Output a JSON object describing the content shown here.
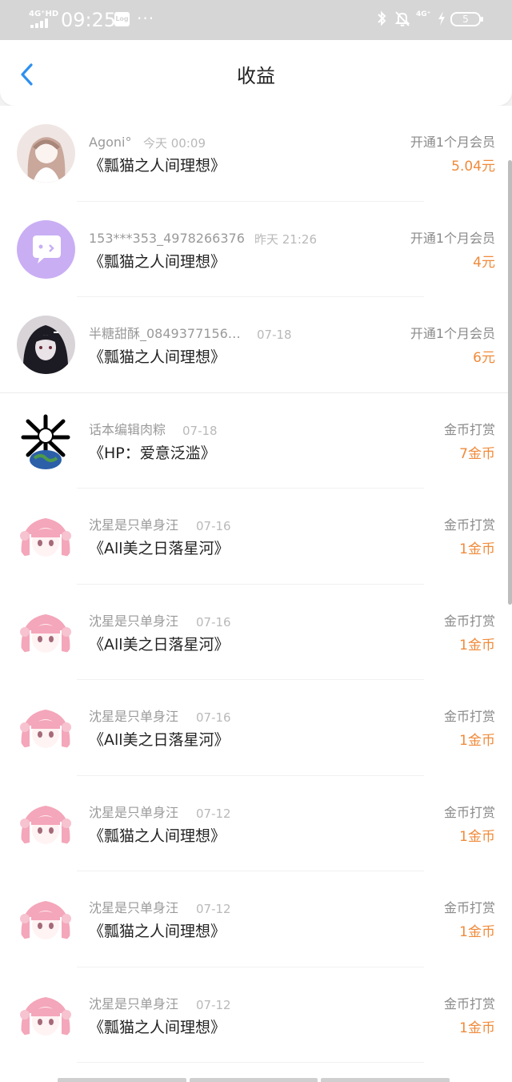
{
  "status_bar": {
    "network": "4G⁺HD",
    "time": "09:25",
    "log_badge": "Log",
    "dots": "···",
    "net_right": "4G⁺",
    "battery": "5"
  },
  "header": {
    "title": "收益"
  },
  "colors": {
    "accent": "#2f8ff0",
    "amount": "#f08a3a"
  },
  "records": [
    {
      "user": "Agoni°",
      "time": "今天 00:09",
      "work": "《瓢猫之人间理想》",
      "type": "开通1个月会员",
      "amount": "5.04元",
      "avatar": "girl-sketch"
    },
    {
      "user": "153***353_4978266376",
      "time": "昨天 21:26",
      "work": "《瓢猫之人间理想》",
      "type": "开通1个月会员",
      "amount": "4元",
      "avatar": "chat-bubble"
    },
    {
      "user": "半糖甜酥_0849377156…",
      "time": "07-18",
      "work": "《瓢猫之人间理想》",
      "type": "开通1个月会员",
      "amount": "6元",
      "avatar": "dark-hair-girl"
    },
    {
      "user": "话本编辑肉粽",
      "time": "07-18",
      "work": "《HP：爱意泛滥》",
      "type": "金币打赏",
      "amount": "7金币",
      "avatar": "bones-globe"
    },
    {
      "user": "沈星是只单身汪",
      "time": "07-16",
      "work": "《All美之日落星河》",
      "type": "金币打赏",
      "amount": "1金币",
      "avatar": "pink-hair-girl"
    },
    {
      "user": "沈星是只单身汪",
      "time": "07-16",
      "work": "《All美之日落星河》",
      "type": "金币打赏",
      "amount": "1金币",
      "avatar": "pink-hair-girl"
    },
    {
      "user": "沈星是只单身汪",
      "time": "07-16",
      "work": "《All美之日落星河》",
      "type": "金币打赏",
      "amount": "1金币",
      "avatar": "pink-hair-girl"
    },
    {
      "user": "沈星是只单身汪",
      "time": "07-12",
      "work": "《瓢猫之人间理想》",
      "type": "金币打赏",
      "amount": "1金币",
      "avatar": "pink-hair-girl"
    },
    {
      "user": "沈星是只单身汪",
      "time": "07-12",
      "work": "《瓢猫之人间理想》",
      "type": "金币打赏",
      "amount": "1金币",
      "avatar": "pink-hair-girl"
    },
    {
      "user": "沈星是只单身汪",
      "time": "07-12",
      "work": "《瓢猫之人间理想》",
      "type": "金币打赏",
      "amount": "1金币",
      "avatar": "pink-hair-girl"
    }
  ]
}
